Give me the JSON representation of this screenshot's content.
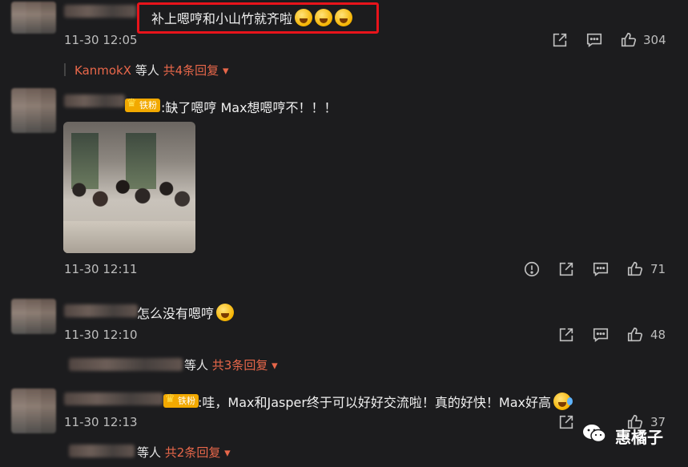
{
  "comments": [
    {
      "text": "补上嗯哼和小山竹就齐啦",
      "time": "11-30 12:05",
      "likes": "304",
      "replies": {
        "who": "KanmokX",
        "deng": "等人",
        "total": "共4条回复"
      }
    },
    {
      "badge": "铁粉",
      "text": ":缺了嗯哼 Max想嗯哼不！！！",
      "time": "11-30 12:11",
      "likes": "71"
    },
    {
      "text": "怎么没有嗯哼",
      "time": "11-30 12:10",
      "likes": "48",
      "replies": {
        "deng": "等人",
        "total": "共3条回复"
      }
    },
    {
      "badge": "铁粉",
      "text": ":哇，Max和Jasper终于可以好好交流啦！真的好快！Max好高",
      "time": "11-30 12:13",
      "likes": "37",
      "replies": {
        "deng": "等人",
        "total": "共2条回复"
      }
    }
  ],
  "watermark": {
    "text": "惠橘子"
  },
  "colors": {
    "background": "#1c1c1e",
    "accent": "#e8674a",
    "highlight": "#e8141b",
    "badge": "#f2a900"
  },
  "icons": [
    "share-icon",
    "comment-icon",
    "like-icon",
    "report-icon",
    "chevron-down-icon",
    "wechat-icon"
  ]
}
